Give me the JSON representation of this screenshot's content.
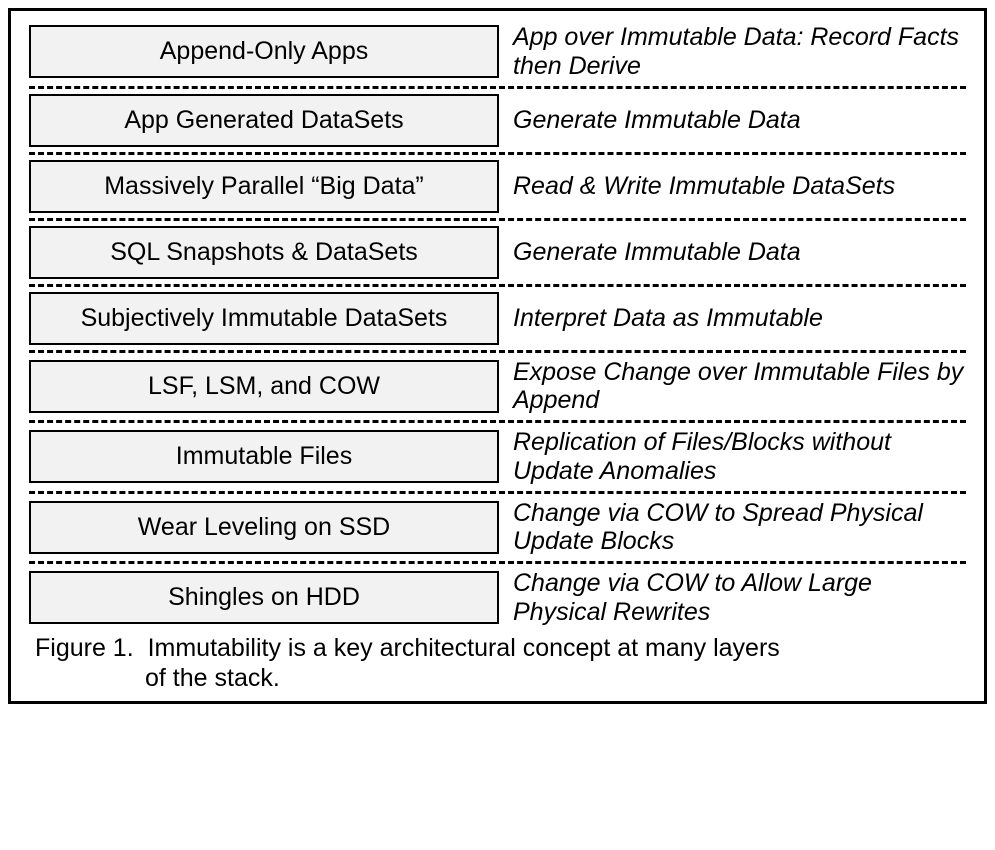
{
  "layers": [
    {
      "name": "Append-Only Apps",
      "desc": "App over Immutable Data: Record Facts then Derive"
    },
    {
      "name": "App Generated DataSets",
      "desc": "Generate Immutable Data"
    },
    {
      "name": "Massively Parallel “Big Data”",
      "desc": "Read & Write Immutable DataSets"
    },
    {
      "name": "SQL Snapshots & DataSets",
      "desc": "Generate Immutable Data"
    },
    {
      "name": "Subjectively Immutable DataSets",
      "desc": "Interpret Data as Immutable"
    },
    {
      "name": "LSF, LSM, and COW",
      "desc": "Expose Change over Immutable Files by Append"
    },
    {
      "name": "Immutable Files",
      "desc": "Replication of Files/Blocks without Update Anomalies"
    },
    {
      "name": "Wear Leveling on SSD",
      "desc": "Change via COW to Spread Physical Update Blocks"
    },
    {
      "name": "Shingles on HDD",
      "desc": "Change via COW to Allow Large Physical Rewrites"
    }
  ],
  "caption": {
    "label": "Figure 1.",
    "line1": "Immutability is a key architectural concept at many layers",
    "line2": "of the stack."
  }
}
